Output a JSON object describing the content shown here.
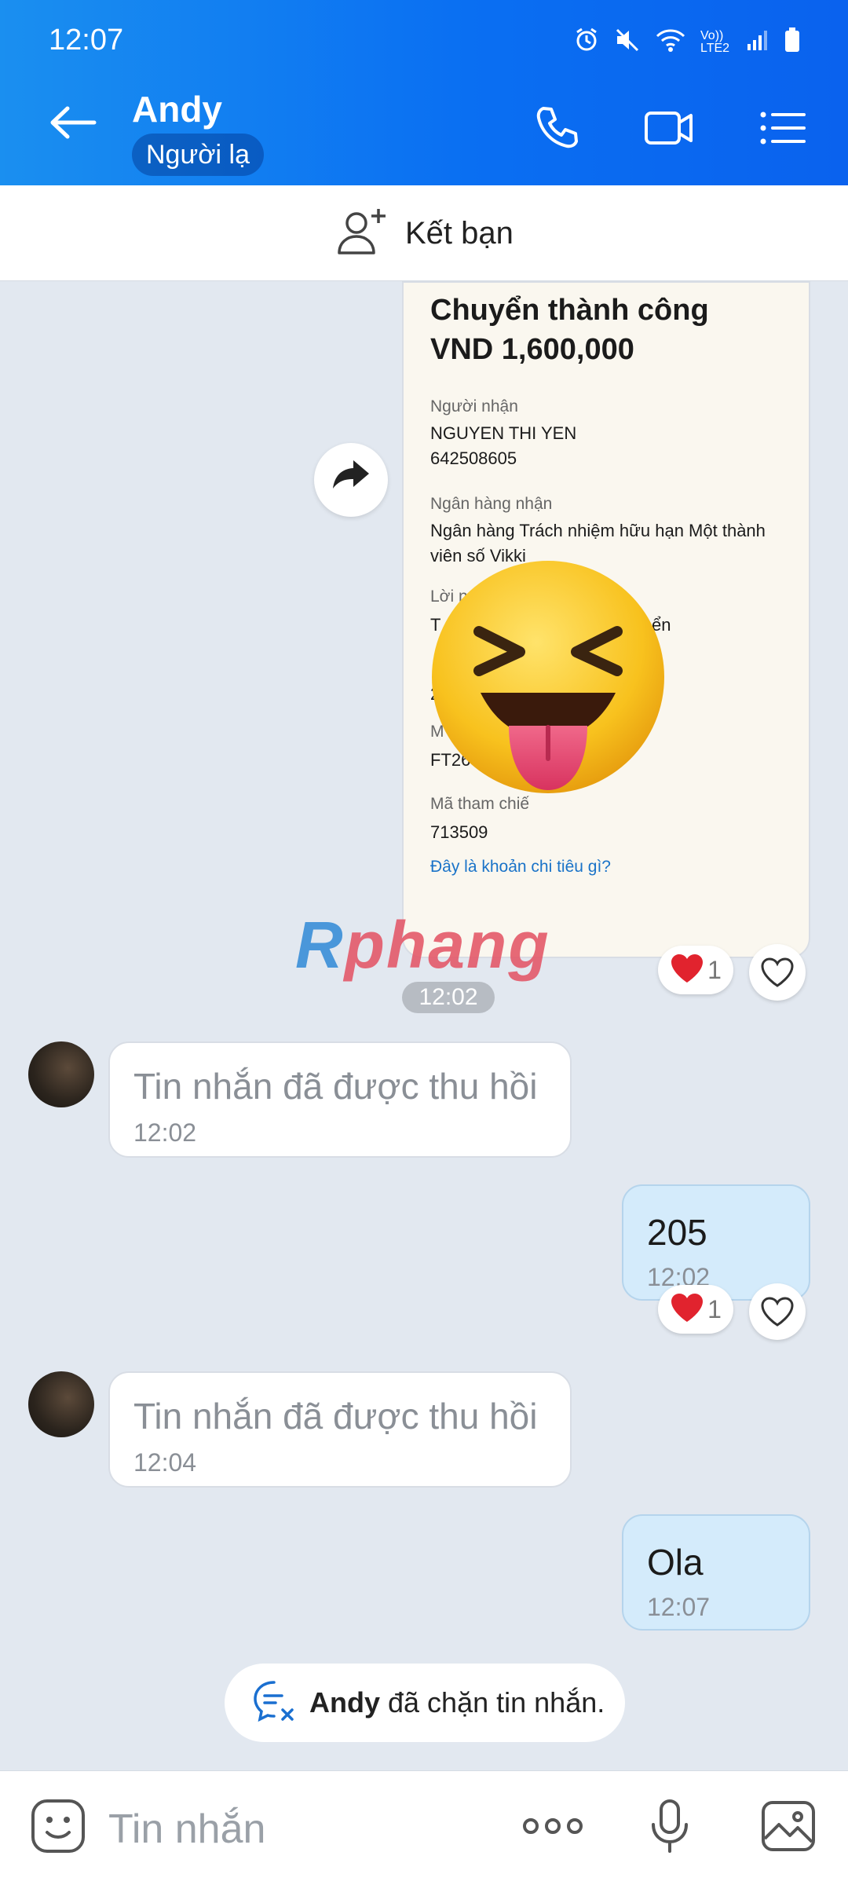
{
  "status_bar": {
    "time": "12:07",
    "network_label": "Vo)) LTE2"
  },
  "header": {
    "contact_name": "Andy",
    "badge": "Người lạ"
  },
  "friend_bar": {
    "label": "Kết bạn"
  },
  "receipt": {
    "title": "Chuyển thành công",
    "amount": "VND 1,600,000",
    "recipient_label": "Người nhận",
    "recipient_name": "NGUYEN THI YEN",
    "recipient_account": "642508605",
    "bank_label": "Ngân hàng nhận",
    "bank_name": "Ngân hàng Trách nhiệm hữu hạn Một thành viên số Vikki",
    "message_label": "Lời n",
    "message_value": "T",
    "message_tail": "ển",
    "digit_fragment": "2",
    "code_label": "M",
    "code_value": "FT26",
    "ref_label": "Mã tham chiế",
    "ref_value": "713509",
    "link": "Đây là khoản chi tiêu gì?",
    "reaction_count": "1"
  },
  "watermark": {
    "first": "R",
    "rest": "phang"
  },
  "time_pill": "12:02",
  "messages": [
    {
      "text": "Tin nhắn đã được thu hồi",
      "time": "12:02"
    },
    {
      "text": "205",
      "time": "12:02",
      "reaction_count": "1"
    },
    {
      "text": "Tin nhắn đã được thu hồi",
      "time": "12:04"
    },
    {
      "text": "Ola",
      "time": "12:07"
    }
  ],
  "blocked_notice": {
    "name": "Andy",
    "text": "đã chặn tin nhắn."
  },
  "composer": {
    "placeholder": "Tin nhắn"
  },
  "colors": {
    "header": "#0a6ff2",
    "bubble_out": "#d4ebfb",
    "background": "#e2e8f0",
    "link": "#1a73c8"
  }
}
